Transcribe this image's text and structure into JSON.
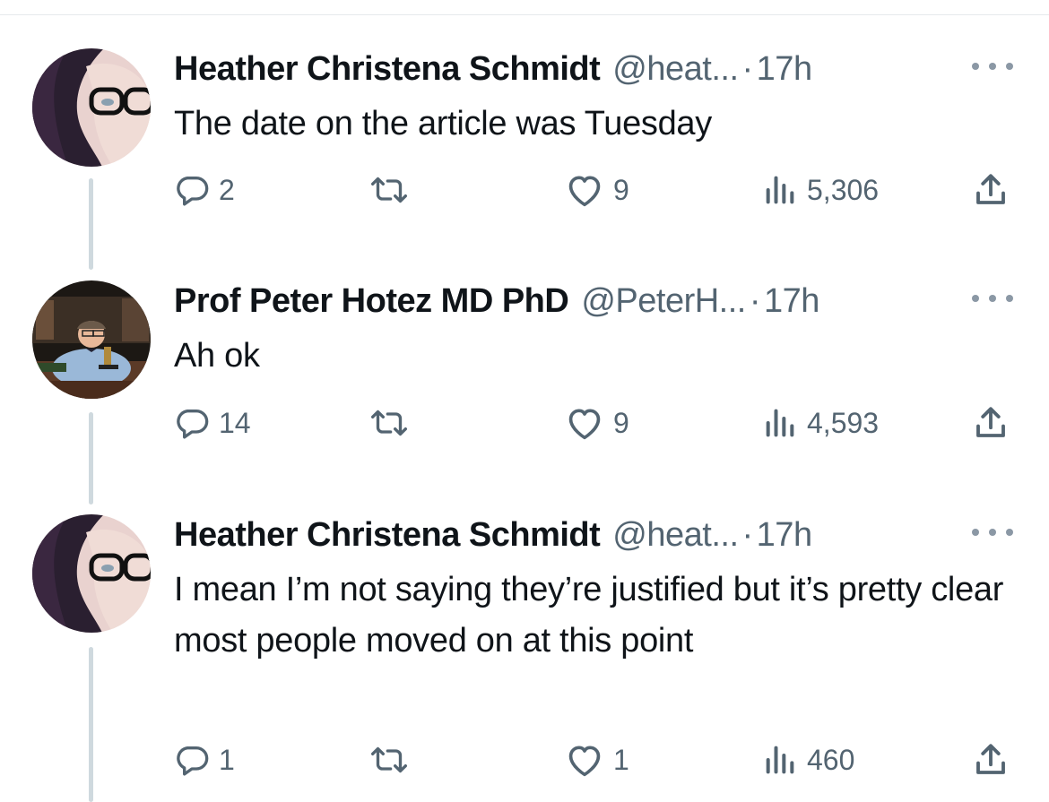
{
  "tweets": [
    {
      "name": "Heather Christena Schmidt",
      "handle": "@heat...",
      "dot": "·",
      "time": "17h",
      "text": "The date on the article was Tuesday",
      "replies": "2",
      "retweets": "",
      "likes": "9",
      "views": "5,306"
    },
    {
      "name": "Prof Peter Hotez MD PhD",
      "handle": "@PeterH...",
      "dot": "·",
      "time": "17h",
      "text": "Ah ok",
      "replies": "14",
      "retweets": "",
      "likes": "9",
      "views": "4,593"
    },
    {
      "name": "Heather Christena Schmidt",
      "handle": "@heat...",
      "dot": "·",
      "time": "17h",
      "text": "I mean I’m not saying they’re justified but it’s pretty clear most people moved on at this point",
      "replies": "1",
      "retweets": "",
      "likes": "1",
      "views": "460"
    }
  ],
  "icons": {
    "reply": "reply-icon",
    "retweet": "retweet-icon",
    "like": "heart-icon",
    "views": "views-bar-chart-icon",
    "share": "share-upload-icon",
    "more": "more-horizontal-icon"
  },
  "colors": {
    "text_primary": "#0f1419",
    "text_secondary": "#536471",
    "thread_line": "#cfd9de"
  }
}
